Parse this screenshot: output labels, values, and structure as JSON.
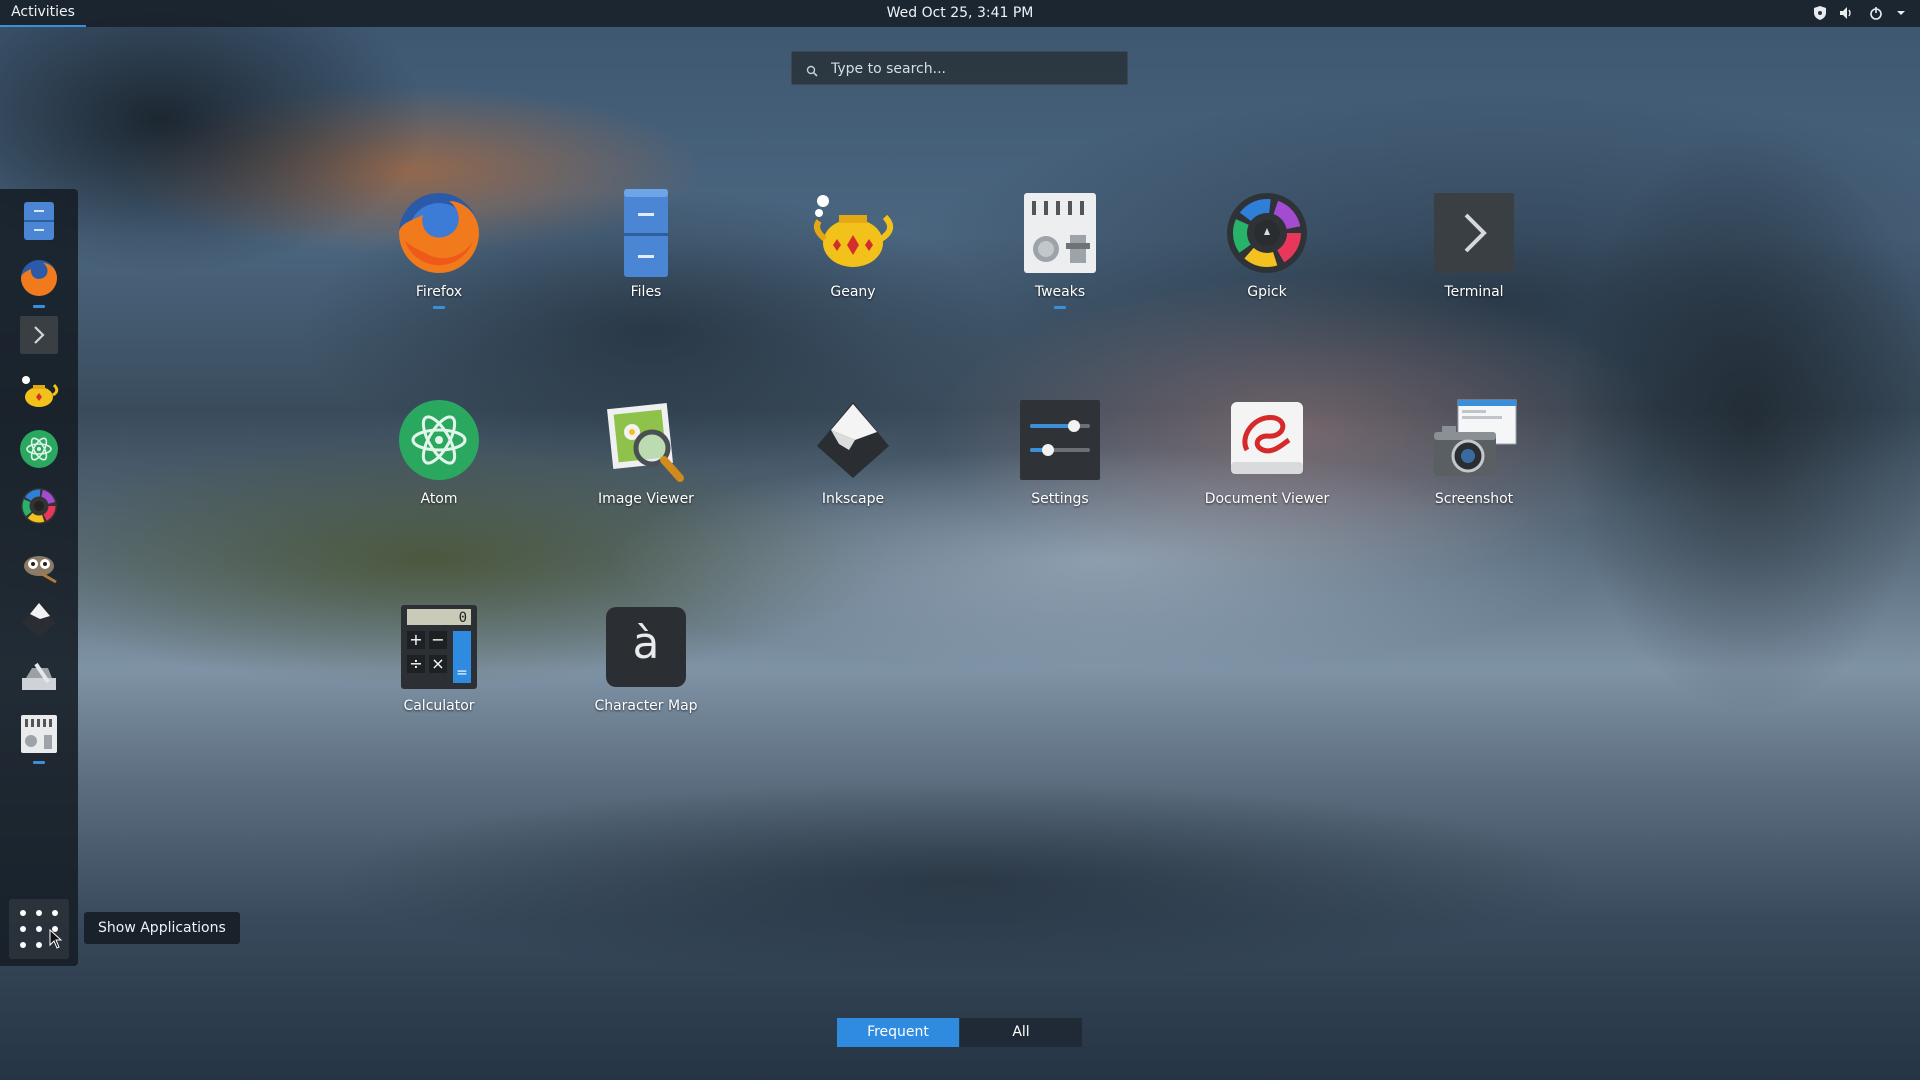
{
  "topbar": {
    "activities": "Activities",
    "clock": "Wed Oct 25,  3:41 PM",
    "tray_icons": [
      "shield-icon",
      "volume-icon",
      "power-icon",
      "chevron-down-icon"
    ]
  },
  "search": {
    "placeholder": "Type to search..."
  },
  "dash": {
    "items": [
      {
        "name": "files-icon",
        "running": false
      },
      {
        "name": "firefox-icon",
        "running": true
      },
      {
        "name": "terminal-icon",
        "running": false
      },
      {
        "name": "geany-icon",
        "running": false
      },
      {
        "name": "atom-icon",
        "running": false
      },
      {
        "name": "gpick-icon",
        "running": false
      },
      {
        "name": "gimp-icon",
        "running": false
      },
      {
        "name": "inkscape-icon",
        "running": false
      },
      {
        "name": "toolbox-icon",
        "running": false
      },
      {
        "name": "tweaks-icon",
        "running": true
      }
    ],
    "show_apps_tooltip": "Show Applications"
  },
  "apps": [
    {
      "label": "Firefox",
      "icon": "firefox-icon",
      "running": true
    },
    {
      "label": "Files",
      "icon": "files-icon",
      "running": false
    },
    {
      "label": "Geany",
      "icon": "geany-icon",
      "running": false
    },
    {
      "label": "Tweaks",
      "icon": "tweaks-icon",
      "running": true
    },
    {
      "label": "Gpick",
      "icon": "gpick-icon",
      "running": false
    },
    {
      "label": "Terminal",
      "icon": "terminal-icon",
      "running": false
    },
    {
      "label": "Atom",
      "icon": "atom-icon",
      "running": false
    },
    {
      "label": "Image Viewer",
      "icon": "image-viewer-icon",
      "running": false
    },
    {
      "label": "Inkscape",
      "icon": "inkscape-icon",
      "running": false
    },
    {
      "label": "Settings",
      "icon": "settings-icon",
      "running": false
    },
    {
      "label": "Document Viewer",
      "icon": "document-viewer-icon",
      "running": false
    },
    {
      "label": "Screenshot",
      "icon": "screenshot-icon",
      "running": false
    },
    {
      "label": "Calculator",
      "icon": "calculator-icon",
      "running": false
    },
    {
      "label": "Character Map",
      "icon": "character-map-icon",
      "running": false
    }
  ],
  "calculator_display": "0",
  "character_map_glyph": "à",
  "view_switch": {
    "frequent": "Frequent",
    "all": "All",
    "active": "Frequent"
  },
  "colors": {
    "accent": "#2f8be0",
    "panel": "#182028"
  }
}
